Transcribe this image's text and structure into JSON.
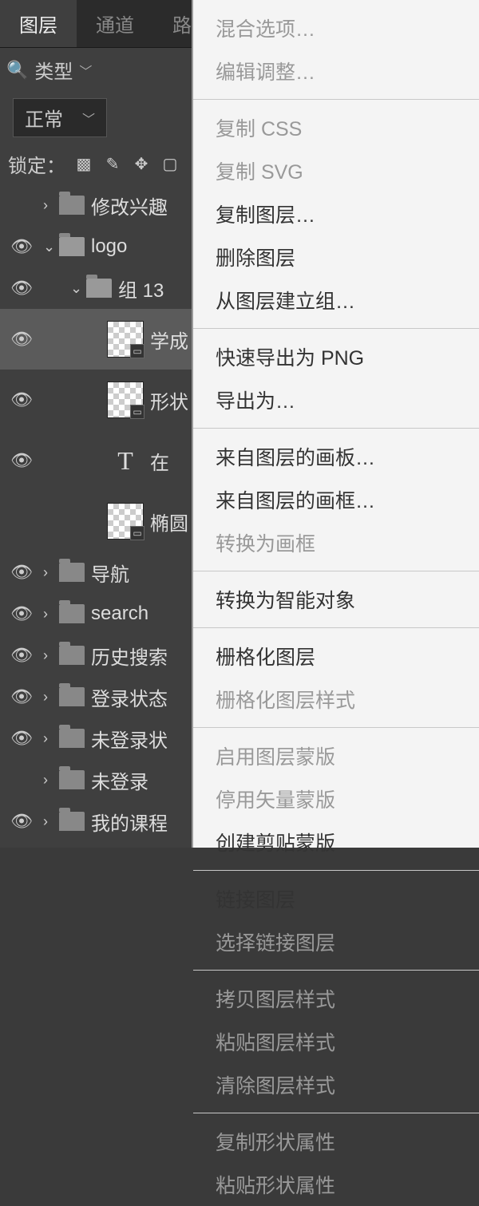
{
  "tabs": {
    "layers": "图层",
    "channels": "通道",
    "paths": "路径"
  },
  "filter": {
    "search_icon": "🔍",
    "type_label": "类型"
  },
  "blend": {
    "mode": "正常"
  },
  "lock": {
    "label": "锁定："
  },
  "layers": [
    {
      "name": "修改兴趣"
    },
    {
      "name": "logo"
    },
    {
      "name": "组 13"
    },
    {
      "name": "学成"
    },
    {
      "name": "形状"
    },
    {
      "name": "在"
    },
    {
      "name": "椭圆"
    },
    {
      "name": "导航"
    },
    {
      "name": "search"
    },
    {
      "name": "历史搜索"
    },
    {
      "name": "登录状态"
    },
    {
      "name": "未登录状"
    },
    {
      "name": "未登录"
    },
    {
      "name": "我的课程"
    }
  ],
  "context_menu": {
    "blending_options": "混合选项…",
    "edit_adjustment": "编辑调整…",
    "copy_css": "复制 CSS",
    "copy_svg": "复制 SVG",
    "duplicate_layer": "复制图层…",
    "delete_layer": "删除图层",
    "group_from_layers": "从图层建立组…",
    "quick_export_png": "快速导出为 PNG",
    "export_as": "导出为…",
    "artboard_from_layers": "来自图层的画板…",
    "frame_from_layers": "来自图层的画框…",
    "convert_to_frame": "转换为画框",
    "convert_to_smart": "转换为智能对象",
    "rasterize_layer": "栅格化图层",
    "rasterize_style": "栅格化图层样式",
    "enable_layer_mask": "启用图层蒙版",
    "disable_vector_mask": "停用矢量蒙版",
    "create_clipping_mask": "创建剪贴蒙版",
    "link_layers": "链接图层",
    "select_linked": "选择链接图层",
    "copy_layer_style": "拷贝图层样式",
    "paste_layer_style": "粘贴图层样式",
    "clear_layer_style": "清除图层样式",
    "copy_shape_attr": "复制形状属性",
    "paste_shape_attr": "粘贴形状属性"
  }
}
